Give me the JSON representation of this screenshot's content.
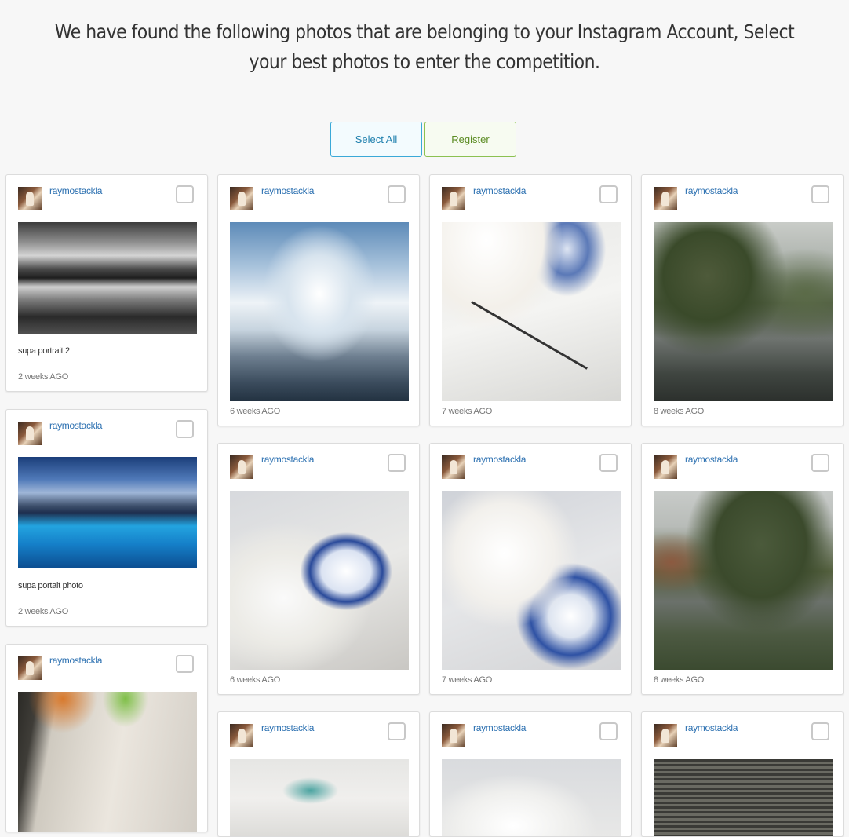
{
  "heading": "We have found the following photos that are belonging to your Instagram Account, Select your best photos to enter the competition.",
  "buttons": {
    "select_all": "Select All",
    "register": "Register"
  },
  "posts": [
    {
      "username": "raymostackla",
      "caption": "supa portrait 2",
      "time": "2 weeks AGO"
    },
    {
      "username": "raymostackla",
      "caption": "supa portait photo",
      "time": "2 weeks AGO"
    },
    {
      "username": "raymostackla",
      "caption": "",
      "time": ""
    },
    {
      "username": "raymostackla",
      "caption": "",
      "time": "6 weeks AGO"
    },
    {
      "username": "raymostackla",
      "caption": "",
      "time": "6 weeks AGO"
    },
    {
      "username": "raymostackla",
      "caption": "",
      "time": ""
    },
    {
      "username": "raymostackla",
      "caption": "",
      "time": "7 weeks AGO"
    },
    {
      "username": "raymostackla",
      "caption": "",
      "time": "7 weeks AGO"
    },
    {
      "username": "raymostackla",
      "caption": "",
      "time": ""
    },
    {
      "username": "raymostackla",
      "caption": "",
      "time": "8 weeks AGO"
    },
    {
      "username": "raymostackla",
      "caption": "",
      "time": "8 weeks AGO"
    },
    {
      "username": "raymostackla",
      "caption": "",
      "time": ""
    }
  ]
}
